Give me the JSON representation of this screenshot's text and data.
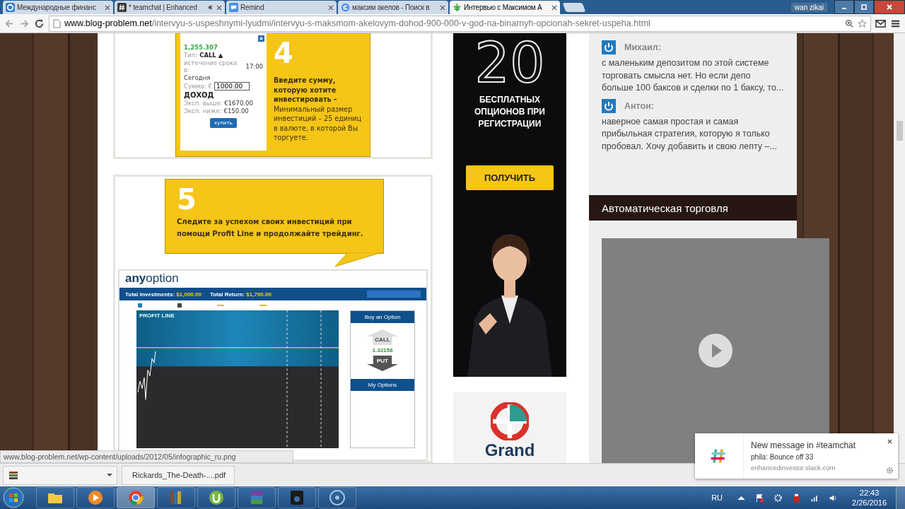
{
  "browser": {
    "tabs": [
      {
        "title": "Международные финанс",
        "kind": "ring",
        "audio": false,
        "selected": false
      },
      {
        "title": "* teamchat | Enhanced",
        "kind": "hash",
        "audio": true,
        "selected": false
      },
      {
        "title": "Remind",
        "kind": "remind",
        "audio": false,
        "selected": false
      },
      {
        "title": "максим акелов - Поиск в",
        "kind": "google",
        "audio": false,
        "selected": false
      },
      {
        "title": "Интервью с Максимом А",
        "kind": "leaf",
        "audio": false,
        "selected": true
      }
    ],
    "profile": "wan zikai",
    "url_host": "www.blog-problem.net",
    "url_path": "/intervyu-s-uspeshnymi-lyudmi/intervyu-s-maksmom-akelovym-dohod-900-000-v-god-na-binarnyh-opcionah-sekret-uspeha.html"
  },
  "step4": {
    "price": "1,255.307",
    "type_label": "Тип:",
    "type_value": "CALL ▲",
    "expiry_label": "истечение срока в:",
    "expiry_value": "17:00",
    "day": "Сегодня",
    "amount_label": "Сумма: €",
    "amount_value": "1000.00",
    "income_heading": "ДОХОД",
    "above_label": "Эксп. выше:",
    "above_value": "€1670.00",
    "below_label": "Эксп. ниже:",
    "below_value": "€150.00",
    "buy_button": "купить",
    "number": "4",
    "text": "**Введите сумму, которую хотите инвестировать –** Минимальный размер инвестиций – 25 единиц в валюте, в которой Вы торгуете."
  },
  "step5": {
    "number": "5",
    "text": "Следите за успехом своих инвестиций при помощи Profit Line и продолжайте трейдинг.",
    "dashboard": {
      "logo": "**any**option",
      "total_investments_label": "Total Investments:",
      "total_investments": "$1,000.00",
      "total_return_label": "Total Return:",
      "total_return": "$1,700.00",
      "chart_label": "PROFIT LINE",
      "buy_title": "Buy an Option",
      "call": "CALL",
      "rate": "1.32158",
      "put": "PUT",
      "my_options": "My Options"
    }
  },
  "ad": {
    "number": "20",
    "text": "БЕСПЛАТНЫХ ОПЦИОНОВ ПРИ РЕГИСТРАЦИИ",
    "button": "ПОЛУЧИТЬ",
    "brand": "Grand"
  },
  "comments": [
    {
      "author": "Михаил:",
      "text": "с маленьким депозитом по этой системе торговать смысла нет. Но если депо больше 100 баксов и сделки по 1 баксу, то..."
    },
    {
      "author": "Антон:",
      "text": "наверное самая простая и самая прибыльная стратегия, которую я только пробовал. Хочу добавить и свою лепту –..."
    }
  ],
  "widget": {
    "title": "Автоматическая торговля"
  },
  "status_url": "www.blog-problem.net/wp-content/uploads/2012/05/infographic_ru.png",
  "downloads": [
    {
      "name": "Rickards_The-Death-....pdf"
    }
  ],
  "notification": {
    "title": "New message in #teamchat",
    "message": "phila: Bounce off 33",
    "source": "enhancedinvestor.slack.com"
  },
  "taskbar": {
    "language": "RU",
    "time": "22:43",
    "date": "2/26/2016"
  }
}
